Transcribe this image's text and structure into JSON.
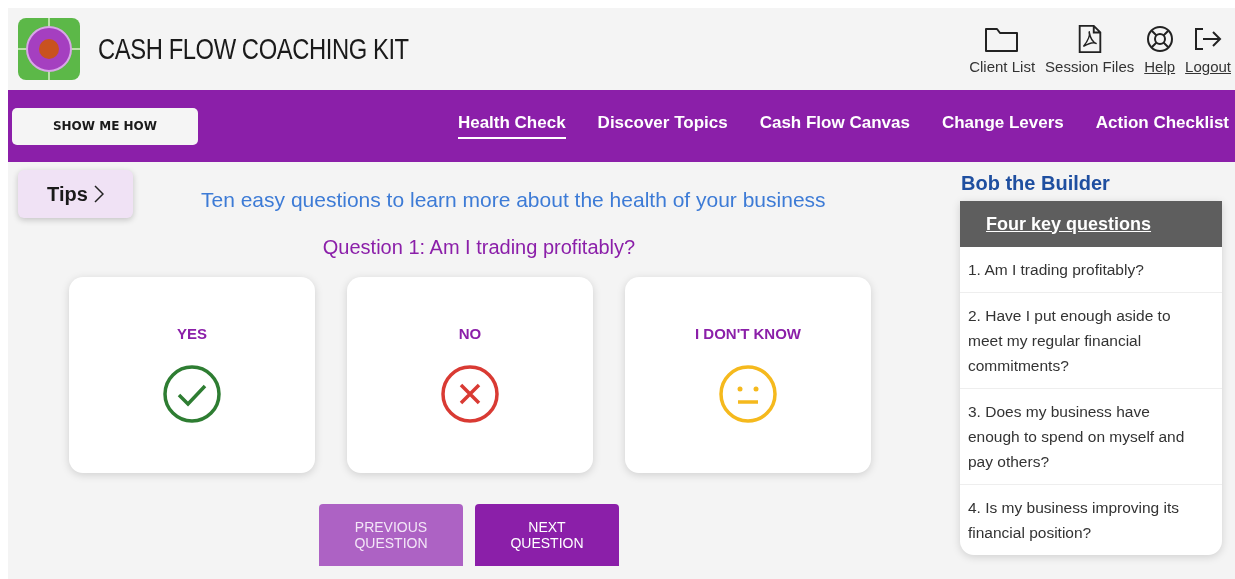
{
  "app_title": "CASH FLOW COACHING KIT",
  "header_links": [
    {
      "label": "Client List",
      "kind": "folder",
      "underlined": false
    },
    {
      "label": "Session Files",
      "kind": "pdf",
      "underlined": false
    },
    {
      "label": "Help",
      "kind": "lifebuoy",
      "underlined": true
    },
    {
      "label": "Logout",
      "kind": "logout",
      "underlined": true
    }
  ],
  "show_me_how": "SHOW ME HOW",
  "tabs": [
    {
      "label": "Health Check",
      "selected": true
    },
    {
      "label": "Discover Topics",
      "selected": false
    },
    {
      "label": "Cash Flow Canvas",
      "selected": false
    },
    {
      "label": "Change Levers",
      "selected": false
    },
    {
      "label": "Action Checklist",
      "selected": false
    }
  ],
  "tips": "Tips",
  "intro": "Ten easy questions to learn more about the health of your business",
  "question": "Question 1: Am I trading profitably?",
  "answers": [
    {
      "label": "YES",
      "kind": "yes"
    },
    {
      "label": "NO",
      "kind": "no"
    },
    {
      "label": "I DON'T KNOW",
      "kind": "unknown"
    }
  ],
  "nav_buttons": [
    {
      "label": "PREVIOUS QUESTION",
      "disabled": true
    },
    {
      "label": "NEXT QUESTION",
      "disabled": false
    }
  ],
  "client_name": "Bob the Builder",
  "key_questions": {
    "title": "Four key questions",
    "items": [
      "1. Am I trading profitably?",
      "2. Have I put enough aside to meet my regular financial commitments?",
      "3. Does my business have enough to spend on myself and pay others?",
      "4. Is my business improving its financial position?"
    ]
  }
}
